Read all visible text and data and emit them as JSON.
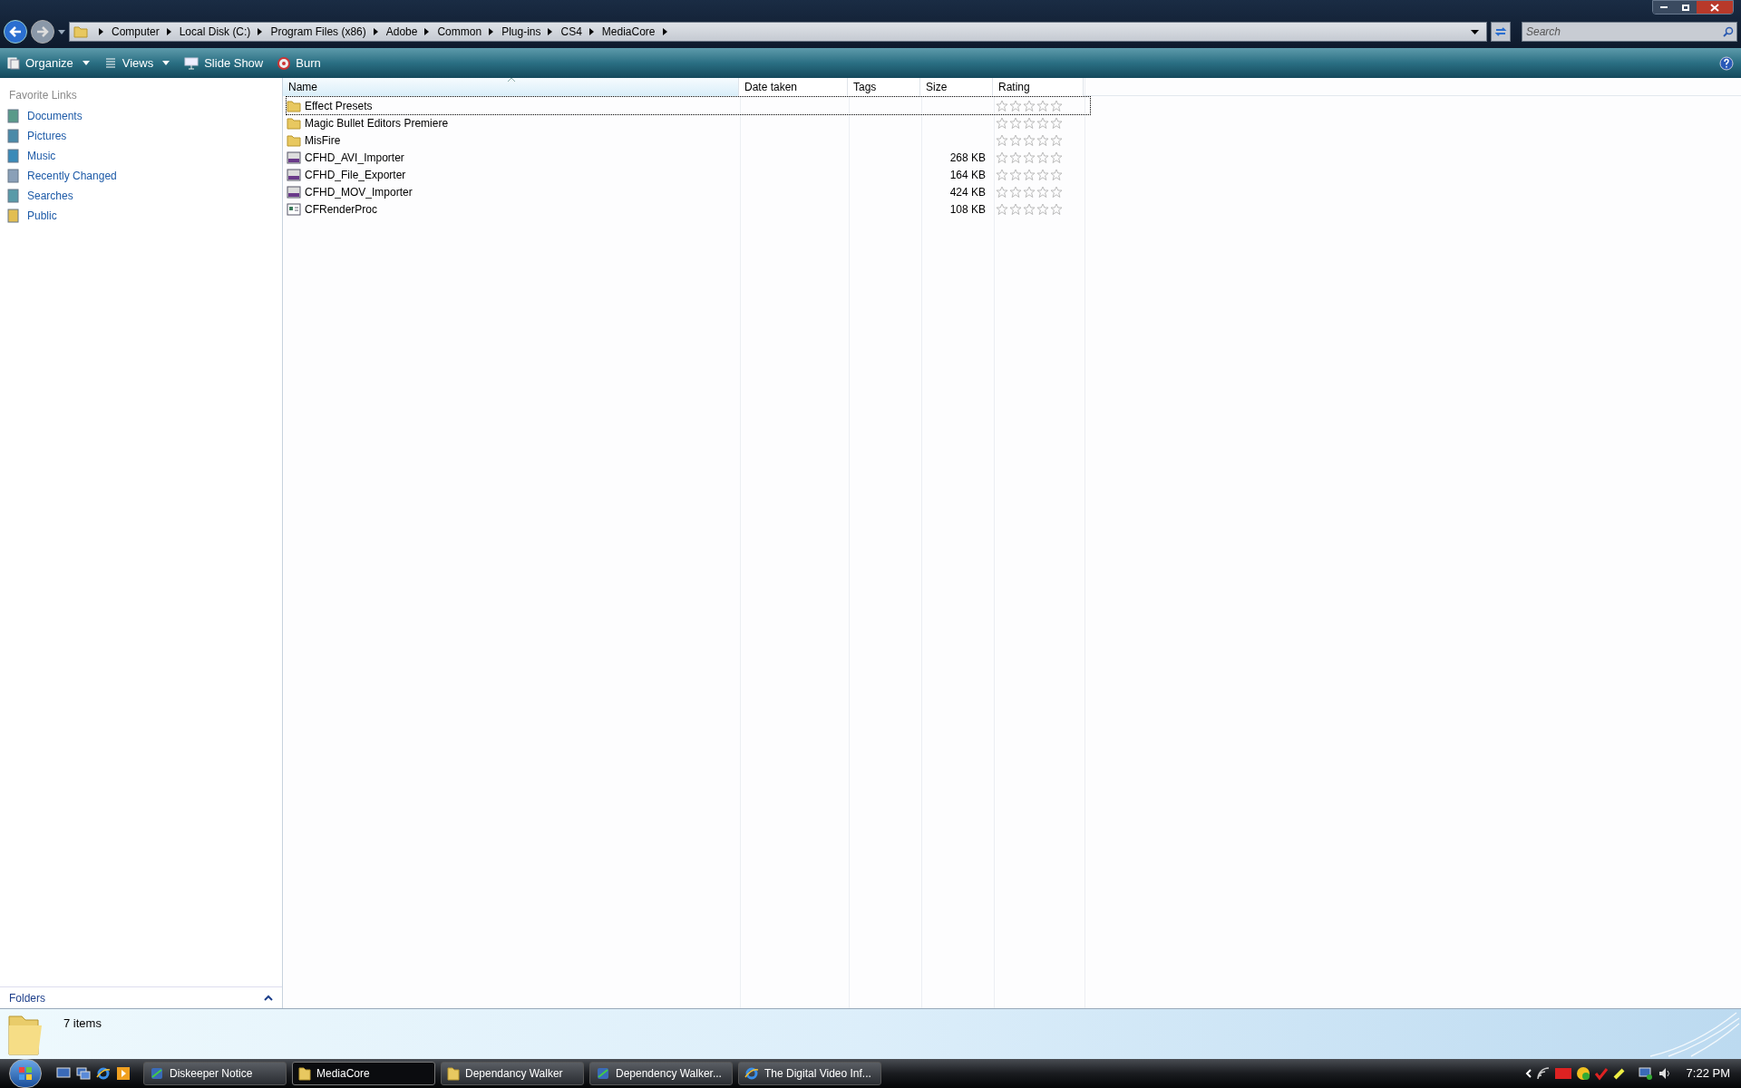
{
  "address_bar": {
    "crumbs": [
      "Computer",
      "Local Disk (C:)",
      "Program Files (x86)",
      "Adobe",
      "Common",
      "Plug-ins",
      "CS4",
      "MediaCore"
    ]
  },
  "search": {
    "placeholder": "Search"
  },
  "toolbar": [
    {
      "label": "Organize",
      "kind": "menu"
    },
    {
      "label": "Views",
      "kind": "menu"
    },
    {
      "label": "Slide Show",
      "kind": "slideshow"
    },
    {
      "label": "Burn",
      "kind": "burn"
    }
  ],
  "sidebar": {
    "title": "Favorite Links",
    "items": [
      {
        "label": "Documents"
      },
      {
        "label": "Pictures"
      },
      {
        "label": "Music"
      },
      {
        "label": "Recently Changed"
      },
      {
        "label": "Searches"
      },
      {
        "label": "Public"
      }
    ],
    "folders_label": "Folders"
  },
  "table": {
    "columns": [
      "Name",
      "Date taken",
      "Tags",
      "Size",
      "Rating"
    ],
    "rows": [
      {
        "kind": "folder",
        "name": "Effect Presets",
        "size": "",
        "stars": 0,
        "selected": true
      },
      {
        "kind": "folder",
        "name": "Magic Bullet Editors Premiere",
        "size": "",
        "stars": 0,
        "selected": false
      },
      {
        "kind": "folder",
        "name": "MisFire",
        "size": "",
        "stars": 0,
        "selected": false
      },
      {
        "kind": "plugin",
        "name": "CFHD_AVI_Importer",
        "size": "268 KB",
        "stars": 0,
        "selected": false
      },
      {
        "kind": "plugin",
        "name": "CFHD_File_Exporter",
        "size": "164 KB",
        "stars": 0,
        "selected": false
      },
      {
        "kind": "plugin",
        "name": "CFHD_MOV_Importer",
        "size": "424 KB",
        "stars": 0,
        "selected": false
      },
      {
        "kind": "app",
        "name": "CFRenderProc",
        "size": "108 KB",
        "stars": 0,
        "selected": false
      }
    ]
  },
  "details": {
    "count": "7 items"
  },
  "taskbar": {
    "buttons": [
      {
        "label": "Diskeeper Notice",
        "kind": "app",
        "selected": false
      },
      {
        "label": "MediaCore",
        "kind": "folder",
        "selected": true
      },
      {
        "label": "Dependancy Walker",
        "kind": "folder",
        "selected": false
      },
      {
        "label": "Dependency Walker...",
        "kind": "app",
        "selected": false
      },
      {
        "label": "The Digital Video Inf...",
        "kind": "browser",
        "selected": false
      }
    ],
    "clock": "7:22 PM"
  }
}
